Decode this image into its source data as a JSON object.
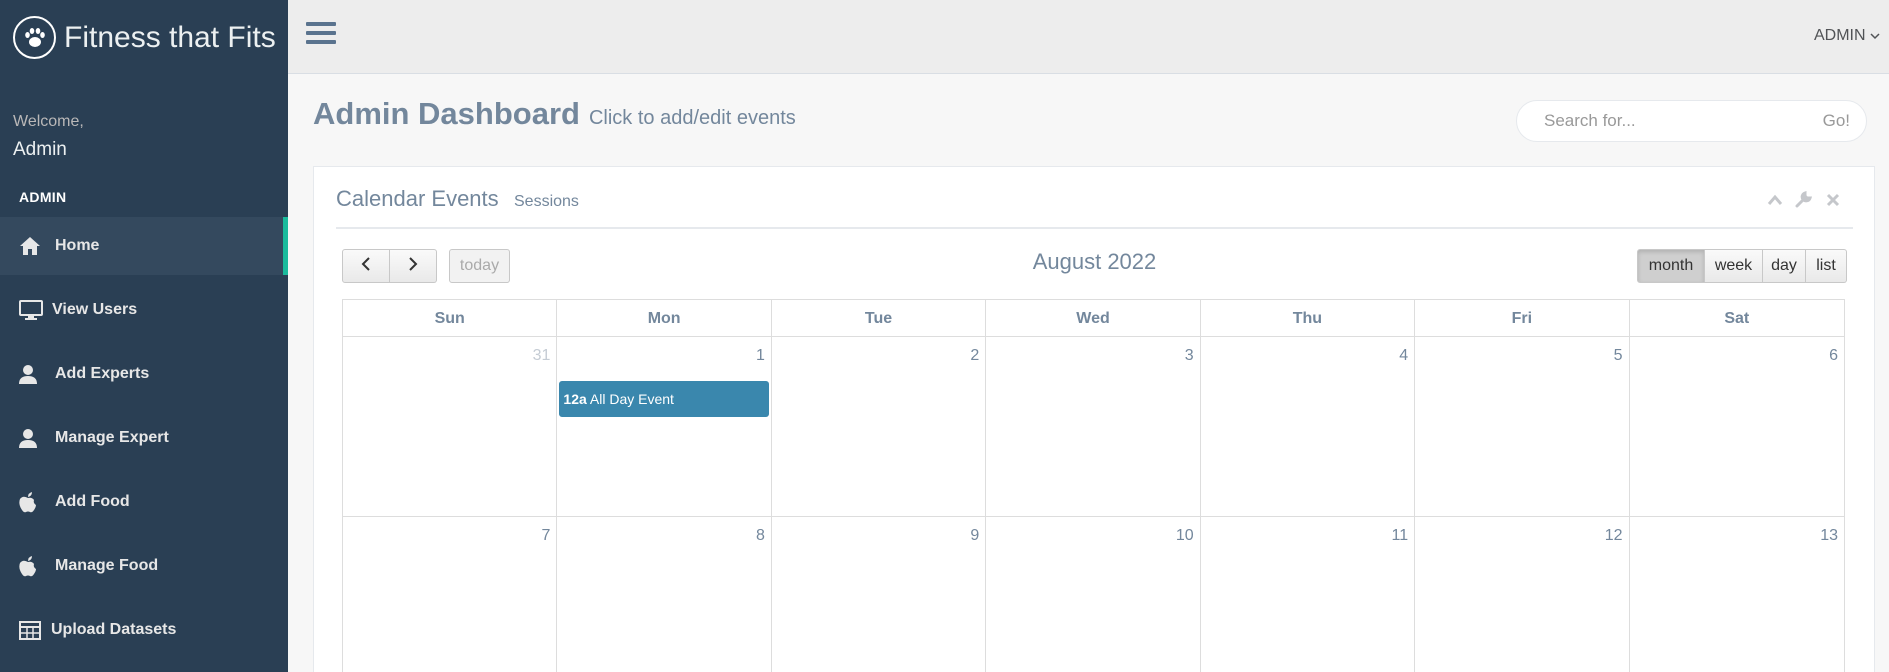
{
  "brand": {
    "title": "Fitness that Fits",
    "icon": "paw-icon"
  },
  "welcome": {
    "label": "Welcome,",
    "name": "Admin"
  },
  "sidebar": {
    "section_title": "ADMIN",
    "items": [
      {
        "label": "Home",
        "icon": "home-icon",
        "active": true
      },
      {
        "label": "View Users",
        "icon": "monitor-icon"
      },
      {
        "label": "Add Experts",
        "icon": "user-icon"
      },
      {
        "label": "Manage Expert",
        "icon": "user-icon"
      },
      {
        "label": "Add Food",
        "icon": "apple-icon"
      },
      {
        "label": "Manage Food",
        "icon": "apple-icon"
      },
      {
        "label": "Upload Datasets",
        "icon": "table-icon"
      }
    ]
  },
  "topnav": {
    "user_label": "ADMIN"
  },
  "page": {
    "title": "Admin Dashboard",
    "subtitle": "Click to add/edit events"
  },
  "search": {
    "placeholder": "Search for...",
    "button": "Go!"
  },
  "panel": {
    "title": "Calendar Events",
    "subtitle": "Sessions"
  },
  "calendar": {
    "title": "August 2022",
    "today_label": "today",
    "views": [
      "month",
      "week",
      "day",
      "list"
    ],
    "active_view": "month",
    "days_of_week": [
      "Sun",
      "Mon",
      "Tue",
      "Wed",
      "Thu",
      "Fri",
      "Sat"
    ],
    "weeks": [
      [
        "31",
        "1",
        "2",
        "3",
        "4",
        "5",
        "6"
      ],
      [
        "7",
        "8",
        "9",
        "10",
        "11",
        "12",
        "13"
      ]
    ],
    "event": {
      "time": "12a",
      "title": "All Day Event"
    }
  },
  "colors": {
    "sidebar": "#2a3f54",
    "accent": "#1abb9c",
    "event": "#3a87ad",
    "title": "#73879c"
  }
}
